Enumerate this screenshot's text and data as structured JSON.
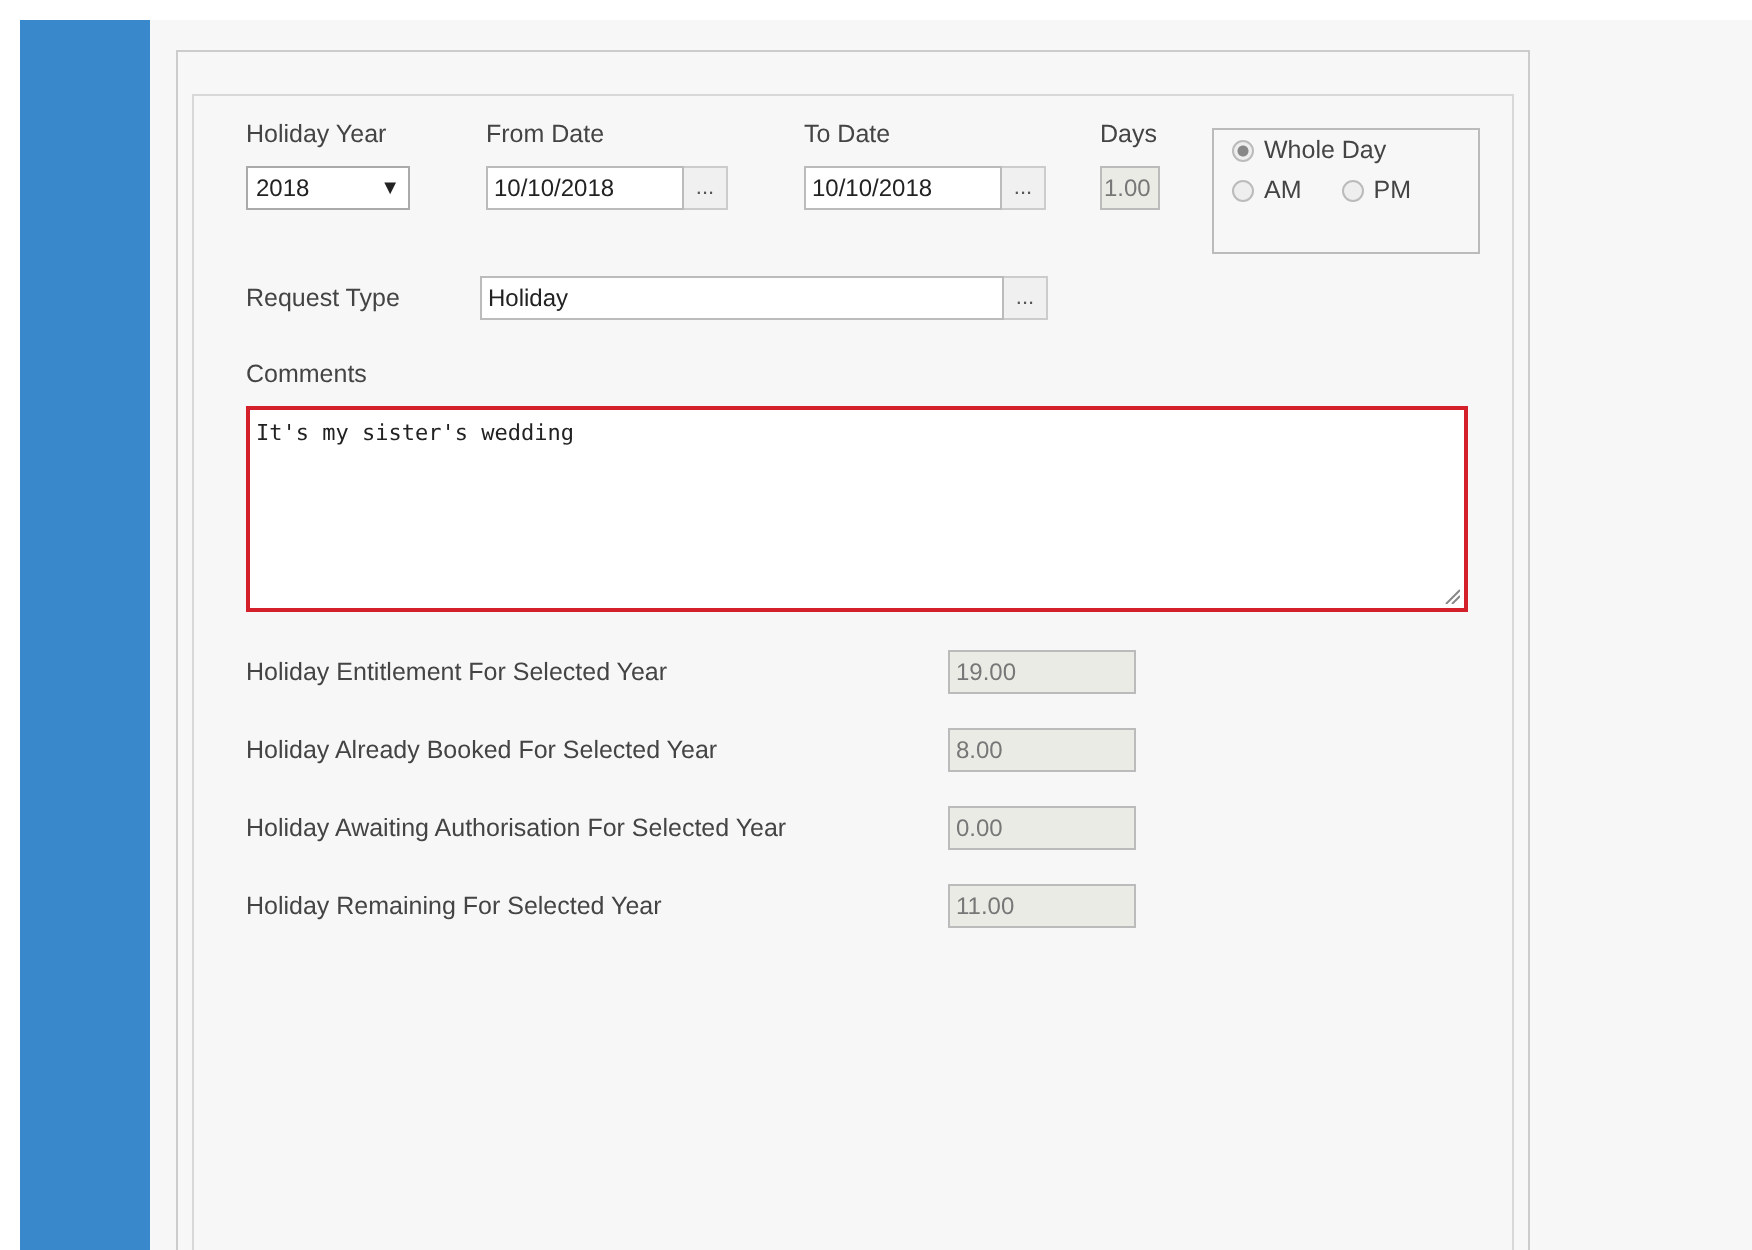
{
  "holiday_year": {
    "label": "Holiday Year",
    "value": "2018",
    "caret": "▼"
  },
  "from_date": {
    "label": "From Date",
    "value": "10/10/2018",
    "button": "..."
  },
  "to_date": {
    "label": "To Date",
    "value": "10/10/2018",
    "button": "..."
  },
  "days": {
    "label": "Days",
    "value": "1.00"
  },
  "day_part": [
    {
      "label": "Whole Day",
      "selected": true
    },
    {
      "label": "AM",
      "selected": false
    },
    {
      "label": "PM",
      "selected": false
    }
  ],
  "request_type": {
    "label": "Request Type",
    "value": "Holiday",
    "button": "..."
  },
  "comments": {
    "label": "Comments",
    "value": "It's my sister's wedding",
    "invalid": true
  },
  "stats": [
    {
      "label": "Holiday Entitlement For Selected Year",
      "value": "19.00"
    },
    {
      "label": "Holiday Already Booked For Selected Year",
      "value": "8.00"
    },
    {
      "label": "Holiday Awaiting Authorisation For Selected Year",
      "value": "0.00"
    },
    {
      "label": "Holiday Remaining For Selected Year",
      "value": "11.00"
    }
  ]
}
